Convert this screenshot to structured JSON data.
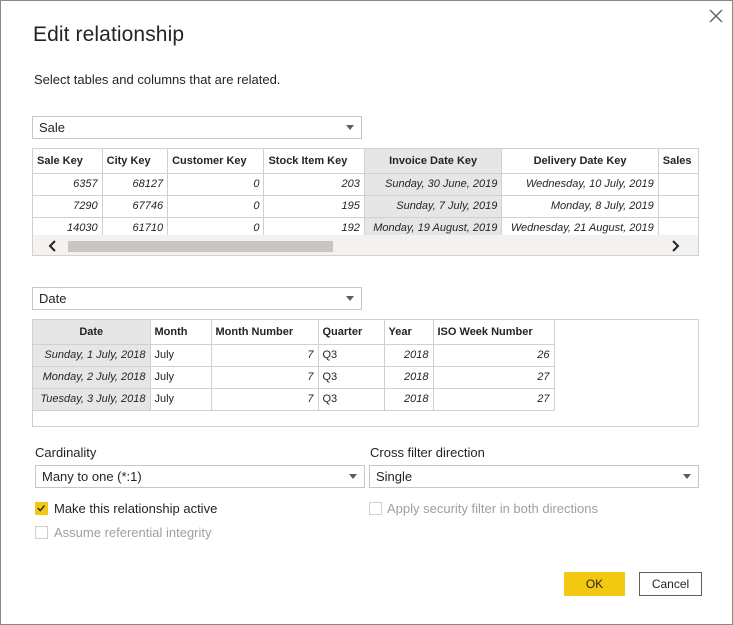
{
  "dialog": {
    "title": "Edit relationship",
    "subtitle": "Select tables and columns that are related."
  },
  "table1": {
    "selected": "Sale",
    "columns": [
      "Sale Key",
      "City Key",
      "Customer Key",
      "Stock Item Key",
      "Invoice Date Key",
      "Delivery Date Key",
      "Sales"
    ],
    "rows": [
      [
        "6357",
        "68127",
        "0",
        "203",
        "Sunday, 30 June, 2019",
        "Wednesday, 10 July, 2019",
        ""
      ],
      [
        "7290",
        "67746",
        "0",
        "195",
        "Sunday, 7 July, 2019",
        "Monday, 8 July, 2019",
        ""
      ],
      [
        "14030",
        "61710",
        "0",
        "192",
        "Monday, 19 August, 2019",
        "Wednesday, 21 August, 2019",
        ""
      ]
    ],
    "highlighted_column": "Invoice Date Key"
  },
  "table2": {
    "selected": "Date",
    "columns": [
      "Date",
      "Month",
      "Month Number",
      "Quarter",
      "Year",
      "ISO Week Number"
    ],
    "rows": [
      [
        "Sunday, 1 July, 2018",
        "July",
        "7",
        "Q3",
        "2018",
        "26"
      ],
      [
        "Monday, 2 July, 2018",
        "July",
        "7",
        "Q3",
        "2018",
        "27"
      ],
      [
        "Tuesday, 3 July, 2018",
        "July",
        "7",
        "Q3",
        "2018",
        "27"
      ]
    ],
    "highlighted_column": "Date"
  },
  "cardinality": {
    "label": "Cardinality",
    "value": "Many to one (*:1)"
  },
  "cross_filter": {
    "label": "Cross filter direction",
    "value": "Single"
  },
  "options": {
    "make_active": {
      "label": "Make this relationship active",
      "checked": true
    },
    "referential_integrity": {
      "label": "Assume referential integrity",
      "checked": false,
      "disabled": true
    },
    "security_filter": {
      "label": "Apply security filter in both directions",
      "checked": false,
      "disabled": true
    }
  },
  "buttons": {
    "ok": "OK",
    "cancel": "Cancel"
  },
  "colors": {
    "accent": "#f2c811",
    "highlight_column": "#e6e6e6",
    "border": "#d2d0ce"
  }
}
